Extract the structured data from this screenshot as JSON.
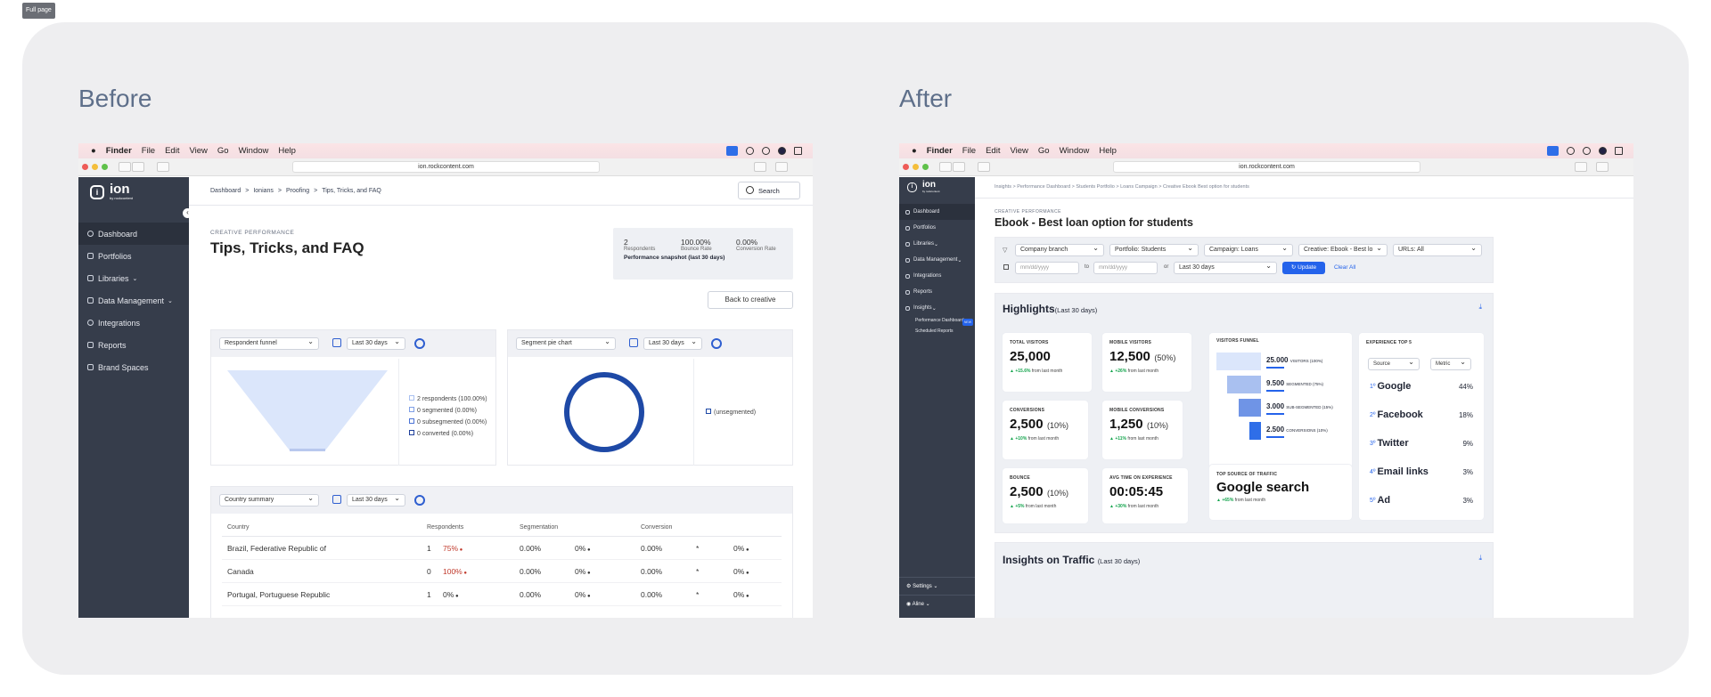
{
  "top_badge": "Full page",
  "headings": {
    "before": "Before",
    "after": "After"
  },
  "mac_menu": {
    "app": "Finder",
    "items": [
      "File",
      "Edit",
      "View",
      "Go",
      "Window",
      "Help"
    ]
  },
  "url": "ion.rockcontent.com",
  "logo": {
    "name": "ion",
    "by": "by rockcontent"
  },
  "before": {
    "sidebar": [
      {
        "label": "Dashboard",
        "icon": "dashboard-icon"
      },
      {
        "label": "Portfolios",
        "icon": "portfolio-icon"
      },
      {
        "label": "Libraries",
        "icon": "libraries-icon"
      },
      {
        "label": "Data Management",
        "icon": "data-icon"
      },
      {
        "label": "Integrations",
        "icon": "integrations-icon"
      },
      {
        "label": "Reports",
        "icon": "reports-icon"
      },
      {
        "label": "Brand Spaces",
        "icon": "brand-icon"
      }
    ],
    "breadcrumb": [
      "Dashboard",
      ">",
      "Ionians",
      ">",
      "Proofing",
      ">",
      "Tips, Tricks, and FAQ"
    ],
    "search": "Search",
    "eyebrow": "CREATIVE PERFORMANCE",
    "title": "Tips, Tricks, and FAQ",
    "snapshot": {
      "respondents": "2",
      "respondents_label": "Respondents",
      "bounce": "100.00%",
      "bounce_label": "Bounce Rate",
      "conv": "0.00%",
      "conv_label": "Conversion Rate",
      "caption": "Performance snapshot (last 30 days)"
    },
    "back": "Back to creative",
    "funnel_select": "Respondent funnel",
    "range": "Last 30 days",
    "funnel_legend": [
      "2 respondents (100.00%)",
      "0 segmented (0.00%)",
      "0 subsegmented (0.00%)",
      "0 converted (0.00%)"
    ],
    "pie_select": "Segment pie chart",
    "pie_legend": "(unsegmented)",
    "country_select": "Country summary",
    "table": {
      "headers": [
        "Country",
        "Respondents",
        "Segmentation",
        "Conversion"
      ],
      "rows": [
        [
          "Brazil, Federative Republic of",
          "1",
          "75%",
          "0.00%",
          "0%",
          "0.00%",
          "*",
          "0%"
        ],
        [
          "Canada",
          "0",
          "100%",
          "0.00%",
          "0%",
          "0.00%",
          "*",
          "0%"
        ],
        [
          "Portugal, Portuguese Republic",
          "1",
          "0%",
          "0.00%",
          "0%",
          "0.00%",
          "*",
          "0%"
        ]
      ]
    }
  },
  "after": {
    "sidebar": [
      {
        "label": "Dashboard",
        "icon": "dashboard-icon"
      },
      {
        "label": "Portfolios",
        "icon": "portfolio-icon"
      },
      {
        "label": "Libraries",
        "icon": "libraries-icon"
      },
      {
        "label": "Data Management",
        "icon": "data-icon"
      },
      {
        "label": "Integrations",
        "icon": "integrations-icon"
      },
      {
        "label": "Reports",
        "icon": "reports-icon"
      },
      {
        "label": "Insights",
        "icon": "insights-icon"
      }
    ],
    "sub": [
      "Performance Dashboard",
      "Scheduled Reports"
    ],
    "new": "NEW",
    "settings": "Settings",
    "user": "Aline",
    "breadcrumb": "Insights  >  Performance Dashboard  >  Students Portfolio  >  Loans Campaign  >  Creative Ebook Best option for students",
    "eyebrow": "CREATIVE PERFORMANCE",
    "title": "Ebook - Best loan option for students",
    "filters": [
      "Company branch",
      "Portfolio: Students",
      "Campaign: Loans",
      "Creative: Ebook - Best lo",
      "URLs: All"
    ],
    "date_ph": "mm/dd/yyyy",
    "to": "to",
    "or": "or",
    "range": "Last 30 days",
    "update": "Update",
    "clear": "Clear All",
    "highlights": "Highlights",
    "highlights_sub": "(Last 30 days)",
    "kpis": [
      {
        "label": "TOTAL VISITORS",
        "value": "25,000",
        "pct": "",
        "delta": "+15.6%",
        "note": "from last month"
      },
      {
        "label": "MOBILE VISITORS",
        "value": "12,500",
        "pct": "(50%)",
        "delta": "+26%",
        "note": "from last month"
      },
      {
        "label": "CONVERSIONS",
        "value": "2,500",
        "pct": "(10%)",
        "delta": "+10%",
        "note": "from last month"
      },
      {
        "label": "MOBILE CONVERSIONS",
        "value": "1,250",
        "pct": "(10%)",
        "delta": "+11%",
        "note": "from last month"
      },
      {
        "label": "BOUNCE",
        "value": "2,500",
        "pct": "(10%)",
        "delta": "+5%",
        "note": "from last month"
      },
      {
        "label": "AVG TIME ON EXPERIENCE",
        "value": "00:05:45",
        "pct": "",
        "delta": "+30%",
        "note": "from last month"
      }
    ],
    "funnel_label": "VISITORS FUNNEL",
    "funnel": [
      {
        "value": "25.000",
        "label": "VISITORS (100%)",
        "frac": 1.0
      },
      {
        "value": "9.500",
        "label": "SEGMENTED (75%)",
        "frac": 0.75
      },
      {
        "value": "3.000",
        "label": "SUB-SEGMENTED (15%)",
        "frac": 0.5
      },
      {
        "value": "2.500",
        "label": "CONVERSIONS (10%)",
        "frac": 0.25
      }
    ],
    "traffic": {
      "label": "TOP SOURCE OF TRAFFIC",
      "value": "Google search",
      "delta": "+65%",
      "note": "from last month"
    },
    "top5": {
      "label": "EXPERIENCE TOP 5",
      "source": "Source",
      "metric": "Metric",
      "items": [
        {
          "rank": "1º",
          "name": "Google",
          "pct": "44%"
        },
        {
          "rank": "2º",
          "name": "Facebook",
          "pct": "18%"
        },
        {
          "rank": "3º",
          "name": "Twitter",
          "pct": "9%"
        },
        {
          "rank": "4º",
          "name": "Email links",
          "pct": "3%"
        },
        {
          "rank": "5º",
          "name": "Ad",
          "pct": "3%"
        }
      ]
    },
    "insights": "Insights on Traffic",
    "insights_sub": "(Last 30 days)"
  },
  "colors": {
    "sidebar": "#363d4b",
    "accent": "#2463eb",
    "funnel_light": "#dbe6fb",
    "donut": "#1e49a6"
  }
}
